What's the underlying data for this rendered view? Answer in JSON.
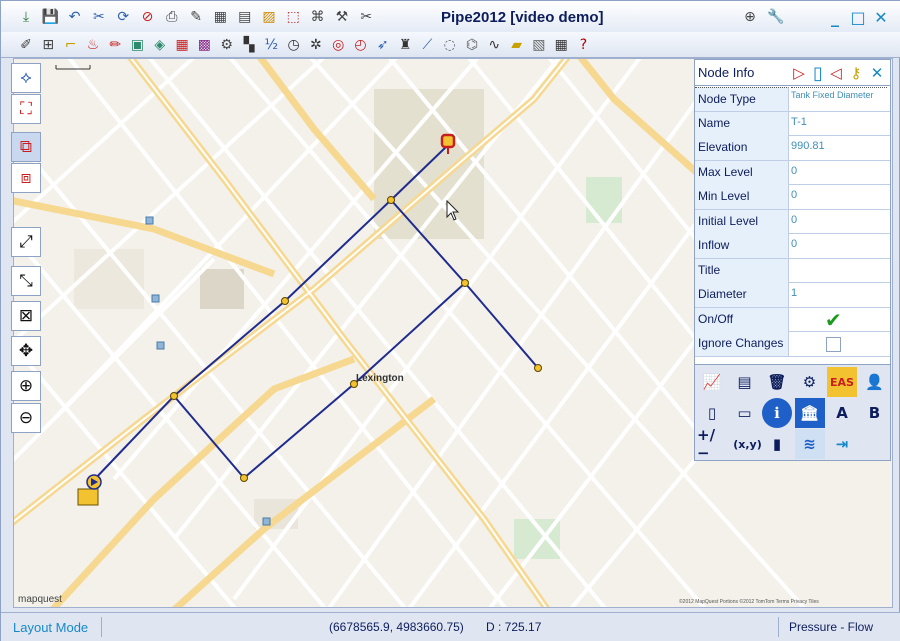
{
  "window": {
    "title": "Pipe2012  [video demo]",
    "controls": [
      {
        "name": "minimize",
        "glyph": "_"
      },
      {
        "name": "maximize",
        "glyph": "□"
      },
      {
        "name": "close",
        "glyph": "✕"
      }
    ]
  },
  "toolbar_top": [
    {
      "name": "export-icon",
      "glyph": "⤓",
      "color": "#2d7a3a"
    },
    {
      "name": "save-icon",
      "glyph": "💾",
      "color": "#1a2a66"
    },
    {
      "name": "undo-icon",
      "glyph": "↶",
      "color": "#2d5fb0"
    },
    {
      "name": "delete-pipes-icon",
      "glyph": "✂",
      "color": "#2d5fb0"
    },
    {
      "name": "refresh-icon",
      "glyph": "⟳",
      "color": "#2d5fb0"
    },
    {
      "name": "stop-icon",
      "glyph": "⊘",
      "color": "#c81e1e"
    },
    {
      "name": "print-icon",
      "glyph": "⎙",
      "color": "#444"
    },
    {
      "name": "draw-icon",
      "glyph": "✎",
      "color": "#444"
    },
    {
      "name": "table-icon",
      "glyph": "▦",
      "color": "#444"
    },
    {
      "name": "report-icon",
      "glyph": "▤",
      "color": "#444"
    },
    {
      "name": "chart-color-icon",
      "glyph": "▨",
      "color": "#d08a00"
    },
    {
      "name": "select-icon",
      "glyph": "⬚",
      "color": "#c81e1e"
    },
    {
      "name": "network-icon",
      "glyph": "⌘",
      "color": "#444"
    },
    {
      "name": "tools-icon",
      "glyph": "⚒",
      "color": "#444"
    },
    {
      "name": "scissors-icon",
      "glyph": "✂",
      "color": "#444"
    }
  ],
  "toolbar_right": [
    {
      "name": "globe-icon",
      "glyph": "⊕",
      "color": "#444"
    },
    {
      "name": "wrench-icon",
      "glyph": "🔧",
      "color": "#c8a000"
    }
  ],
  "toolbar_second": [
    {
      "name": "edit-layout-icon",
      "glyph": "✐",
      "color": "#444"
    },
    {
      "name": "grid-table-icon",
      "glyph": "⊞",
      "color": "#444"
    },
    {
      "name": "pipe-select-icon",
      "glyph": "⌐",
      "color": "#c8a000"
    },
    {
      "name": "fire-hydrant-icon",
      "glyph": "♨",
      "color": "#c81e1e"
    },
    {
      "name": "pencil-icon",
      "glyph": "✏",
      "color": "#c81e1e"
    },
    {
      "name": "map-icon",
      "glyph": "▣",
      "color": "#2d8a6a"
    },
    {
      "name": "color-map-icon",
      "glyph": "◈",
      "color": "#2d8a6a"
    },
    {
      "name": "table-grid-icon",
      "glyph": "▦",
      "color": "#c81e1e"
    },
    {
      "name": "palette-icon",
      "glyph": "▩",
      "color": "#8a2d8a"
    },
    {
      "name": "wrench-small-icon",
      "glyph": "⚙",
      "color": "#444"
    },
    {
      "name": "checker-icon",
      "glyph": "▚",
      "color": "#333"
    },
    {
      "name": "numbers-icon",
      "glyph": "½",
      "color": "#2d5fb0"
    },
    {
      "name": "clock-icon",
      "glyph": "◷",
      "color": "#333"
    },
    {
      "name": "gear-icon",
      "glyph": "✲",
      "color": "#333"
    },
    {
      "name": "target-icon",
      "glyph": "◎",
      "color": "#c81e1e"
    },
    {
      "name": "gauge-icon",
      "glyph": "◴",
      "color": "#c81e1e"
    },
    {
      "name": "arrow-icon",
      "glyph": "➶",
      "color": "#2d5fb0"
    },
    {
      "name": "tower-icon",
      "glyph": "♜",
      "color": "#333"
    },
    {
      "name": "slope-icon",
      "glyph": "⟋",
      "color": "#2d5fb0"
    },
    {
      "name": "node-icon",
      "glyph": "◌",
      "color": "#666"
    },
    {
      "name": "pipe-icon",
      "glyph": "⌬",
      "color": "#666"
    },
    {
      "name": "wave-icon",
      "glyph": "∿",
      "color": "#333"
    },
    {
      "name": "image-icon",
      "glyph": "▰",
      "color": "#c8a000"
    },
    {
      "name": "settings-icon",
      "glyph": "▧",
      "color": "#666"
    },
    {
      "name": "calculator-icon",
      "glyph": "▦",
      "color": "#333"
    },
    {
      "name": "help-icon",
      "glyph": "?",
      "color": "#b00000"
    }
  ],
  "left_toolbar": [
    {
      "name": "zoom-network-icon",
      "glyph": "⟡",
      "color": "#2d5fb0"
    },
    {
      "name": "nodes-icon",
      "glyph": "⛶",
      "color": "#c81e1e"
    },
    {
      "name": "pipes-select-icon",
      "glyph": "⧉",
      "color": "#c81e1e"
    },
    {
      "name": "map-layer-icon",
      "glyph": "⧈",
      "color": "#c81e1e"
    },
    {
      "name": "zoom-extents-icon",
      "glyph": "⤢",
      "color": "#111"
    },
    {
      "name": "zoom-box-icon",
      "glyph": "⤡",
      "color": "#111"
    },
    {
      "name": "zoom-window-icon",
      "glyph": "⊠",
      "color": "#111"
    },
    {
      "name": "pan-icon",
      "glyph": "✥",
      "color": "#111"
    },
    {
      "name": "zoom-in-icon",
      "glyph": "⊕",
      "color": "#111"
    },
    {
      "name": "zoom-out-icon",
      "glyph": "⊖",
      "color": "#111"
    }
  ],
  "node_info": {
    "title": "Node Info",
    "rows": [
      {
        "key": "Node Type",
        "value": "Tank Fixed Diameter"
      },
      {
        "key": "Name",
        "value": "T-1"
      },
      {
        "key": "Elevation",
        "value": "990.81"
      },
      {
        "key": "Max Level",
        "value": "0"
      },
      {
        "key": "Min Level",
        "value": "0"
      },
      {
        "key": "Initial Level",
        "value": "0"
      },
      {
        "key": "Inflow",
        "value": "0"
      },
      {
        "key": "Title",
        "value": ""
      },
      {
        "key": "Diameter",
        "value": "1"
      },
      {
        "key": "On/Off",
        "value": ""
      },
      {
        "key": "Ignore Changes",
        "value": ""
      }
    ],
    "onoff_checked": true,
    "ignore_changes_checked": false,
    "tools": [
      {
        "name": "graph-icon",
        "label": "",
        "glyph": "📈"
      },
      {
        "name": "list-icon",
        "label": "",
        "glyph": "▤"
      },
      {
        "name": "trash-icon",
        "label": "",
        "glyph": "🗑"
      },
      {
        "name": "node-settings-icon",
        "label": "",
        "glyph": "⚙"
      },
      {
        "name": "eas-icon",
        "label": "EAS",
        "glyph": ""
      },
      {
        "name": "user-icon",
        "label": "",
        "glyph": "👤"
      },
      {
        "name": "copy-icon",
        "label": "",
        "glyph": "▯"
      },
      {
        "name": "paste-icon",
        "label": "",
        "glyph": "▭"
      },
      {
        "name": "info-icon",
        "label": "",
        "glyph": "ℹ"
      },
      {
        "name": "bank-icon",
        "label": "",
        "glyph": "🏛"
      },
      {
        "name": "text-a-icon",
        "label": "A",
        "glyph": ""
      },
      {
        "name": "text-b-icon",
        "label": "B",
        "glyph": ""
      },
      {
        "name": "plus-minus-icon",
        "label": "+/−",
        "glyph": ""
      },
      {
        "name": "xy-icon",
        "label": "(x,y)",
        "glyph": ""
      },
      {
        "name": "book-icon",
        "label": "",
        "glyph": "▮"
      },
      {
        "name": "water-icon",
        "label": "",
        "glyph": "≋"
      },
      {
        "name": "connect-icon",
        "label": "",
        "glyph": "⇥"
      }
    ]
  },
  "map": {
    "city_label": "Lexington",
    "attribution": "mapquest",
    "copyright": "©2012 MapQuest  Portions ©2012 TomTom  Terms  Privacy  Tiles"
  },
  "status": {
    "mode": "Layout Mode",
    "coords": "(6678565.9, 4983660.75)",
    "distance": "D : 725.17",
    "display": "Pressure - Flow"
  },
  "colors": {
    "pipe": "#1f2b8f",
    "node": "#f2c230",
    "accent": "#1789c8",
    "panel_key_bg": "#e6f0fb"
  }
}
